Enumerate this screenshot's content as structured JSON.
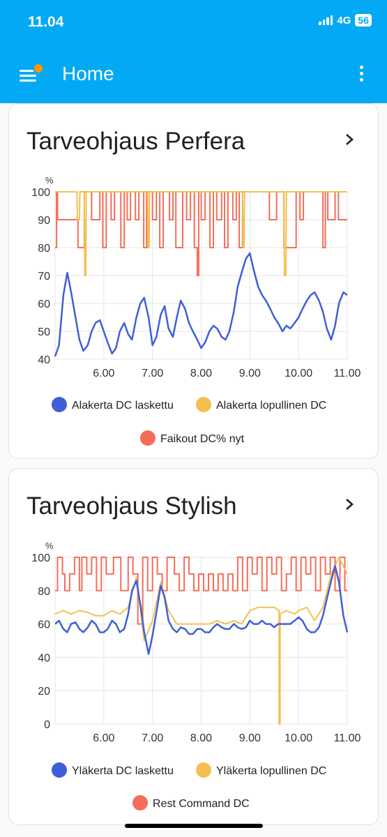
{
  "status_bar": {
    "time": "11.04",
    "network": "4G",
    "battery": "56"
  },
  "app_bar": {
    "title": "Home"
  },
  "colors": {
    "primary": "#03a9f4",
    "badge": "#ff9800",
    "blue": "#3f5fd6",
    "yellow": "#f4bf4f",
    "red": "#f56d58"
  },
  "cards": [
    {
      "title": "Tarveohjaus Perfera",
      "chart_data": {
        "type": "line",
        "ylabel": "%",
        "ylim": [
          40,
          100
        ],
        "yticks": [
          "100",
          "90",
          "80",
          "70",
          "60",
          "50",
          "40"
        ],
        "xlim": [
          5.0,
          11.0
        ],
        "xticks": [
          "6.00",
          "7.00",
          "8.00",
          "9.00",
          "10.00",
          "11.00"
        ],
        "series": [
          {
            "name": "Alakerta DC laskettu",
            "color": "#3f5fd6",
            "x": [
              5.0,
              5.08,
              5.17,
              5.25,
              5.33,
              5.42,
              5.5,
              5.58,
              5.67,
              5.75,
              5.83,
              5.92,
              6.0,
              6.08,
              6.17,
              6.25,
              6.33,
              6.42,
              6.5,
              6.58,
              6.67,
              6.75,
              6.83,
              6.92,
              7.0,
              7.08,
              7.17,
              7.25,
              7.33,
              7.42,
              7.5,
              7.58,
              7.67,
              7.75,
              7.83,
              7.92,
              8.0,
              8.08,
              8.17,
              8.25,
              8.33,
              8.42,
              8.5,
              8.58,
              8.67,
              8.75,
              8.83,
              8.92,
              9.0,
              9.08,
              9.17,
              9.25,
              9.33,
              9.42,
              9.5,
              9.58,
              9.67,
              9.75,
              9.83,
              9.92,
              10.0,
              10.08,
              10.17,
              10.25,
              10.33,
              10.42,
              10.5,
              10.58,
              10.67,
              10.75,
              10.83,
              10.92,
              11.0
            ],
            "y": [
              41,
              45,
              63,
              71,
              64,
              55,
              47,
              43,
              45,
              50,
              53,
              54,
              50,
              46,
              42,
              44,
              50,
              53,
              49,
              47,
              55,
              60,
              62,
              55,
              45,
              48,
              56,
              59,
              51,
              48,
              55,
              61,
              58,
              53,
              50,
              47,
              44,
              46,
              50,
              52,
              51,
              48,
              47,
              50,
              57,
              66,
              71,
              76,
              78,
              72,
              66,
              63,
              61,
              58,
              55,
              53,
              50,
              52,
              51,
              53,
              55,
              58,
              61,
              63,
              64,
              61,
              57,
              51,
              47,
              52,
              60,
              64,
              63
            ]
          },
          {
            "name": "Alakerta lopullinen DC",
            "color": "#f4bf4f",
            "x": [
              5.0,
              5.45,
              5.46,
              5.5,
              5.51,
              5.6,
              5.61,
              5.63,
              5.64,
              6.9,
              6.91,
              6.93,
              6.94,
              8.85,
              8.86,
              8.88,
              8.89,
              9.7,
              9.71,
              9.74,
              9.75,
              11.0
            ],
            "y": [
              100,
              100,
              90,
              90,
              100,
              100,
              70,
              70,
              100,
              100,
              80,
              80,
              100,
              100,
              80,
              80,
              100,
              100,
              70,
              70,
              100,
              100
            ]
          },
          {
            "name": "Faikout DC% nyt",
            "color": "#f56d58",
            "x": [
              5.0,
              5.03,
              5.03,
              5.05,
              5.05,
              5.47,
              5.47,
              5.6,
              5.6,
              5.75,
              5.75,
              5.92,
              5.92,
              5.98,
              5.98,
              6.05,
              6.05,
              6.15,
              6.15,
              6.22,
              6.22,
              6.35,
              6.35,
              6.42,
              6.42,
              6.48,
              6.48,
              6.55,
              6.55,
              6.65,
              6.65,
              6.72,
              6.72,
              6.82,
              6.82,
              6.88,
              6.88,
              7.0,
              7.0,
              7.08,
              7.08,
              7.15,
              7.15,
              7.22,
              7.22,
              7.35,
              7.35,
              7.42,
              7.42,
              7.48,
              7.48,
              7.62,
              7.62,
              7.7,
              7.7,
              7.78,
              7.78,
              7.86,
              7.86,
              7.92,
              7.92,
              7.95,
              7.95,
              8.0,
              8.0,
              8.08,
              8.08,
              8.18,
              8.18,
              8.25,
              8.25,
              8.32,
              8.32,
              8.42,
              8.42,
              8.48,
              8.48,
              8.55,
              8.55,
              8.65,
              8.65,
              8.72,
              8.72,
              8.78,
              8.78,
              8.85,
              8.85,
              9.4,
              9.4,
              9.55,
              9.55,
              9.7,
              9.7,
              9.95,
              9.95,
              10.03,
              10.03,
              10.1,
              10.1,
              10.5,
              10.5,
              10.55,
              10.55,
              10.6,
              10.6,
              10.75,
              10.75,
              10.82,
              10.82,
              11.0
            ],
            "y": [
              80,
              80,
              100,
              100,
              90,
              90,
              80,
              80,
              100,
              100,
              90,
              90,
              100,
              100,
              80,
              80,
              100,
              100,
              90,
              90,
              100,
              100,
              80,
              80,
              100,
              100,
              90,
              90,
              100,
              100,
              90,
              90,
              100,
              100,
              80,
              80,
              100,
              100,
              90,
              90,
              100,
              100,
              80,
              80,
              100,
              100,
              90,
              90,
              100,
              100,
              80,
              80,
              100,
              100,
              90,
              90,
              100,
              100,
              80,
              80,
              70,
              70,
              100,
              100,
              90,
              90,
              100,
              100,
              80,
              80,
              100,
              100,
              90,
              90,
              100,
              100,
              80,
              80,
              100,
              100,
              90,
              90,
              100,
              100,
              80,
              80,
              100,
              100,
              90,
              90,
              100,
              100,
              80,
              80,
              100,
              100,
              90,
              90,
              100,
              100,
              80,
              80,
              100,
              100,
              90,
              90,
              100,
              100,
              90,
              90
            ]
          }
        ]
      }
    },
    {
      "title": "Tarveohjaus Stylish",
      "chart_data": {
        "type": "line",
        "ylabel": "%",
        "ylim": [
          0,
          100
        ],
        "yticks": [
          "100",
          "80",
          "60",
          "40",
          "20",
          "0"
        ],
        "xlim": [
          5.0,
          11.0
        ],
        "xticks": [
          "6.00",
          "7.00",
          "8.00",
          "9.00",
          "10.00",
          "11.00"
        ],
        "series": [
          {
            "name": "Yläkerta DC laskettu",
            "color": "#3f5fd6",
            "x": [
              5.0,
              5.08,
              5.17,
              5.25,
              5.33,
              5.42,
              5.5,
              5.58,
              5.67,
              5.75,
              5.83,
              5.92,
              6.0,
              6.08,
              6.17,
              6.25,
              6.33,
              6.42,
              6.5,
              6.58,
              6.67,
              6.75,
              6.83,
              6.92,
              7.0,
              7.08,
              7.17,
              7.25,
              7.33,
              7.42,
              7.5,
              7.58,
              7.67,
              7.75,
              7.83,
              7.92,
              8.0,
              8.08,
              8.17,
              8.25,
              8.33,
              8.42,
              8.5,
              8.58,
              8.67,
              8.75,
              8.83,
              8.92,
              9.0,
              9.08,
              9.17,
              9.25,
              9.33,
              9.42,
              9.5,
              9.58,
              9.67,
              9.75,
              9.83,
              9.92,
              10.0,
              10.08,
              10.17,
              10.25,
              10.33,
              10.42,
              10.5,
              10.58,
              10.67,
              10.75,
              10.83,
              10.92,
              11.0
            ],
            "y": [
              60,
              62,
              57,
              55,
              60,
              61,
              57,
              55,
              58,
              62,
              60,
              55,
              55,
              57,
              62,
              60,
              55,
              57,
              66,
              80,
              86,
              72,
              55,
              42,
              53,
              67,
              83,
              76,
              62,
              57,
              55,
              58,
              57,
              54,
              54,
              57,
              57,
              55,
              55,
              58,
              60,
              58,
              57,
              57,
              60,
              58,
              57,
              58,
              62,
              60,
              60,
              62,
              60,
              60,
              58,
              60,
              60,
              60,
              60,
              62,
              64,
              62,
              57,
              55,
              55,
              58,
              65,
              75,
              86,
              95,
              85,
              65,
              55
            ]
          },
          {
            "name": "Yläkerta lopullinen DC",
            "color": "#f4bf4f",
            "x": [
              5.0,
              5.17,
              5.33,
              5.5,
              5.67,
              5.83,
              6.0,
              6.17,
              6.33,
              6.5,
              6.67,
              6.83,
              7.0,
              7.17,
              7.33,
              7.5,
              7.67,
              7.83,
              8.0,
              8.17,
              8.33,
              8.5,
              8.67,
              8.83,
              9.0,
              9.17,
              9.33,
              9.5,
              9.6,
              9.6,
              9.62,
              9.62,
              9.75,
              9.92,
              10.0,
              10.17,
              10.33,
              10.5,
              10.67,
              10.83,
              11.0
            ],
            "y": [
              66,
              68,
              66,
              68,
              67,
              65,
              65,
              68,
              66,
              70,
              88,
              50,
              62,
              85,
              68,
              60,
              60,
              60,
              60,
              60,
              62,
              60,
              62,
              60,
              68,
              70,
              70,
              70,
              68,
              0,
              0,
              66,
              68,
              66,
              68,
              70,
              62,
              70,
              90,
              100,
              90,
              60,
              60
            ]
          },
          {
            "name": "Rest Command DC",
            "color": "#f56d58",
            "x": [
              5.0,
              5.05,
              5.05,
              5.15,
              5.15,
              5.2,
              5.2,
              5.3,
              5.3,
              5.4,
              5.4,
              5.5,
              5.5,
              5.55,
              5.55,
              5.65,
              5.65,
              5.75,
              5.75,
              5.85,
              5.85,
              5.95,
              5.95,
              6.05,
              6.05,
              6.2,
              6.2,
              6.35,
              6.35,
              6.5,
              6.5,
              6.6,
              6.6,
              6.7,
              6.7,
              6.8,
              6.8,
              6.9,
              6.9,
              7.0,
              7.0,
              7.1,
              7.1,
              7.2,
              7.2,
              7.3,
              7.3,
              7.45,
              7.45,
              7.55,
              7.55,
              7.65,
              7.65,
              7.75,
              7.75,
              7.85,
              7.85,
              7.95,
              7.95,
              8.05,
              8.05,
              8.15,
              8.15,
              8.25,
              8.25,
              8.35,
              8.35,
              8.45,
              8.45,
              8.55,
              8.55,
              8.65,
              8.65,
              8.75,
              8.75,
              8.85,
              8.85,
              8.95,
              8.95,
              9.05,
              9.05,
              9.15,
              9.15,
              9.25,
              9.25,
              9.35,
              9.35,
              9.45,
              9.45,
              9.55,
              9.55,
              9.65,
              9.65,
              9.75,
              9.75,
              9.85,
              9.85,
              9.95,
              9.95,
              10.05,
              10.05,
              10.15,
              10.15,
              10.25,
              10.25,
              10.35,
              10.35,
              10.45,
              10.45,
              10.55,
              10.55,
              10.65,
              10.65,
              10.75,
              10.75,
              10.85,
              10.85,
              10.95,
              10.95,
              11.0
            ],
            "y": [
              80,
              80,
              100,
              100,
              90,
              90,
              80,
              80,
              90,
              90,
              100,
              100,
              80,
              80,
              100,
              100,
              90,
              90,
              100,
              100,
              80,
              80,
              100,
              100,
              90,
              90,
              100,
              100,
              80,
              80,
              100,
              100,
              90,
              90,
              60,
              60,
              100,
              100,
              80,
              80,
              100,
              100,
              90,
              90,
              80,
              80,
              100,
              100,
              90,
              90,
              80,
              80,
              100,
              100,
              90,
              90,
              80,
              80,
              90,
              90,
              80,
              80,
              90,
              90,
              80,
              80,
              90,
              90,
              80,
              80,
              90,
              90,
              80,
              80,
              100,
              100,
              80,
              80,
              100,
              100,
              90,
              90,
              100,
              100,
              80,
              80,
              100,
              100,
              90,
              90,
              100,
              100,
              80,
              80,
              90,
              90,
              100,
              100,
              80,
              80,
              100,
              100,
              90,
              90,
              100,
              100,
              80,
              80,
              100,
              100,
              90,
              90,
              100,
              100,
              80,
              80,
              100,
              100,
              80,
              80
            ]
          }
        ]
      }
    }
  ]
}
